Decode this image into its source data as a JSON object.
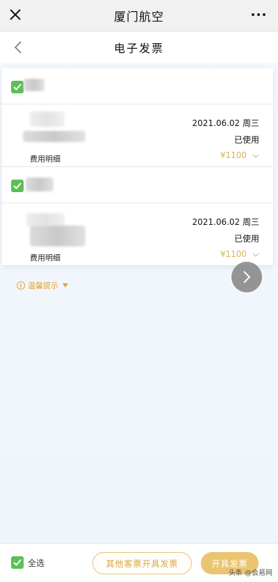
{
  "topbar": {
    "title": "厦门航空",
    "close_icon": "close-icon",
    "more_icon": "more-dots-icon"
  },
  "navbar": {
    "title": "电子发票",
    "back_icon": "chevron-left-icon"
  },
  "groups": [
    {
      "checked": true,
      "order": {
        "date": "2021.06.02 周三",
        "status": "已使用",
        "price": "¥1100",
        "detail_label": "费用明细"
      }
    },
    {
      "checked": true,
      "order": {
        "date": "2021.06.02 周三",
        "status": "已使用",
        "price": "¥1100",
        "detail_label": "费用明细"
      }
    }
  ],
  "tips": {
    "label": "温馨提示"
  },
  "bottom": {
    "select_all_label": "全选",
    "other_button": "其他客票开具发票",
    "issue_button": "开具发票"
  },
  "watermark": "头条 @会易网",
  "colors": {
    "accent_gold": "#eac571",
    "check_green": "#5bbf56",
    "tip_orange": "#e1a23f"
  }
}
